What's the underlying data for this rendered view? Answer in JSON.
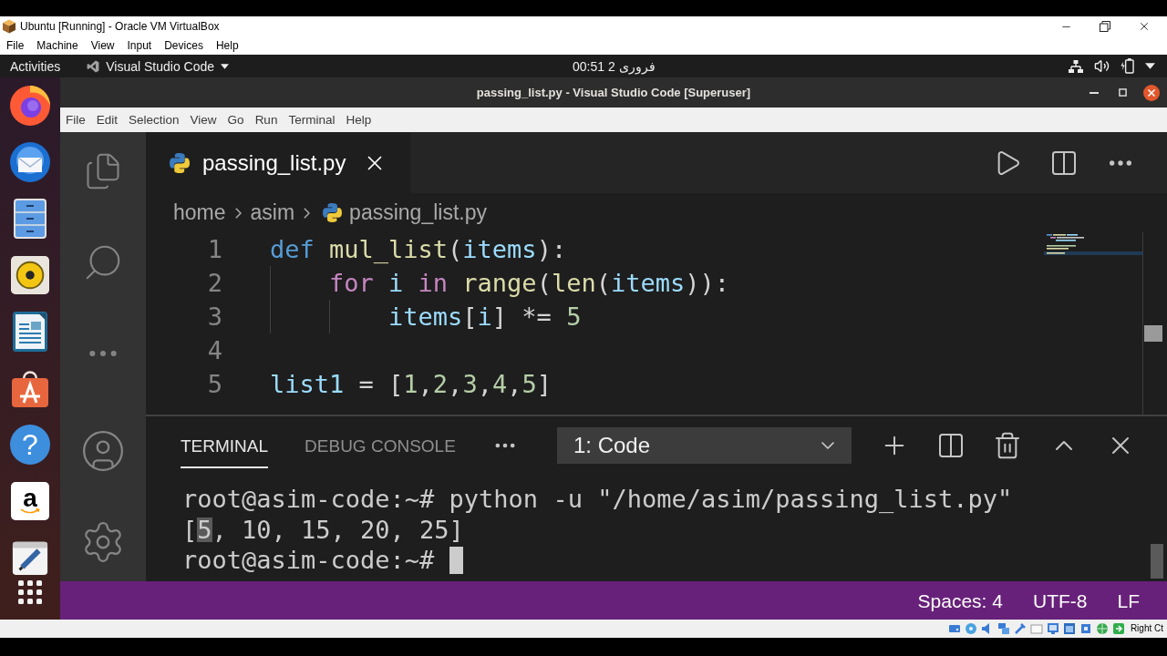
{
  "virtualbox": {
    "title": "Ubuntu [Running] - Oracle VM VirtualBox",
    "menu": [
      "File",
      "Machine",
      "View",
      "Input",
      "Devices",
      "Help"
    ],
    "host_key": "Right Ct"
  },
  "top_bar": {
    "activities": "Activities",
    "app_menu": "Visual Studio Code",
    "clock": "فروری 2 00:51"
  },
  "dock": [
    {
      "kind": "browser"
    },
    {
      "kind": "mail"
    },
    {
      "kind": "files"
    },
    {
      "kind": "music"
    },
    {
      "kind": "writer"
    },
    {
      "kind": "store"
    },
    {
      "kind": "help",
      "glyph": "?"
    },
    {
      "kind": "shop",
      "glyph": "a"
    },
    {
      "kind": "editor"
    }
  ],
  "vscode": {
    "title": "passing_list.py - Visual Studio Code [Superuser]",
    "menu": [
      "File",
      "Edit",
      "Selection",
      "View",
      "Go",
      "Run",
      "Terminal",
      "Help"
    ],
    "tabs": [
      {
        "label": "passing_list.py",
        "selected": true
      }
    ],
    "breadcrumb": [
      "home",
      "asim",
      "passing_list.py"
    ],
    "lines": [
      {
        "number": "1",
        "tokens": [
          {
            "text": "def ",
            "kind": "storage"
          },
          {
            "text": "mul_list",
            "kind": "function"
          },
          {
            "text": "(",
            "kind": "plain"
          },
          {
            "text": "items",
            "kind": "variable"
          },
          {
            "text": "):",
            "kind": "plain"
          }
        ]
      },
      {
        "number": "2",
        "tokens": [
          {
            "text": "    for ",
            "kind": "control"
          },
          {
            "text": "i ",
            "kind": "variable"
          },
          {
            "text": "in ",
            "kind": "control"
          },
          {
            "text": "range",
            "kind": "function"
          },
          {
            "text": "(",
            "kind": "plain"
          },
          {
            "text": "len",
            "kind": "function"
          },
          {
            "text": "(",
            "kind": "plain"
          },
          {
            "text": "items",
            "kind": "variable"
          },
          {
            "text": ")):",
            "kind": "plain"
          }
        ]
      },
      {
        "number": "3",
        "tokens": [
          {
            "text": "        items",
            "kind": "variable"
          },
          {
            "text": "[",
            "kind": "plain"
          },
          {
            "text": "i",
            "kind": "variable"
          },
          {
            "text": "] *= ",
            "kind": "plain"
          },
          {
            "text": "5",
            "kind": "number"
          }
        ]
      },
      {
        "number": "4"
      },
      {
        "number": "5",
        "tokens": [
          {
            "text": "list1",
            "kind": "variable"
          },
          {
            "text": " = [",
            "kind": "plain"
          },
          {
            "text": "1",
            "kind": "number"
          },
          {
            "text": ",",
            "kind": "plain"
          },
          {
            "text": "2",
            "kind": "number"
          },
          {
            "text": ",",
            "kind": "plain"
          },
          {
            "text": "3",
            "kind": "number"
          },
          {
            "text": ",",
            "kind": "plain"
          },
          {
            "text": "4",
            "kind": "number"
          },
          {
            "text": ",",
            "kind": "plain"
          },
          {
            "text": "5",
            "kind": "number"
          },
          {
            "text": "]",
            "kind": "plain"
          }
        ]
      }
    ],
    "panel": {
      "tabs": [
        {
          "label": "TERMINAL",
          "selected": true
        },
        {
          "label": "DEBUG CONSOLE",
          "selected": false
        }
      ],
      "terminal_select": "1: Code",
      "terminal": [
        {
          "segments": [
            {
              "text": "root@asim-code:~# python -u \"/home/asim/passing_list.py\"",
              "selected": false
            }
          ],
          "cursor": false
        },
        {
          "segments": [
            {
              "text": "[",
              "selected": false
            },
            {
              "text": "5",
              "selected": true
            },
            {
              "text": ", 10, 15, 20, 25]",
              "selected": false
            }
          ],
          "cursor": false
        },
        {
          "segments": [
            {
              "text": "root@asim-code:~#",
              "selected": false
            }
          ],
          "cursor": true
        }
      ]
    },
    "status_bar": [
      "Spaces: 4",
      "UTF-8",
      "LF"
    ]
  }
}
